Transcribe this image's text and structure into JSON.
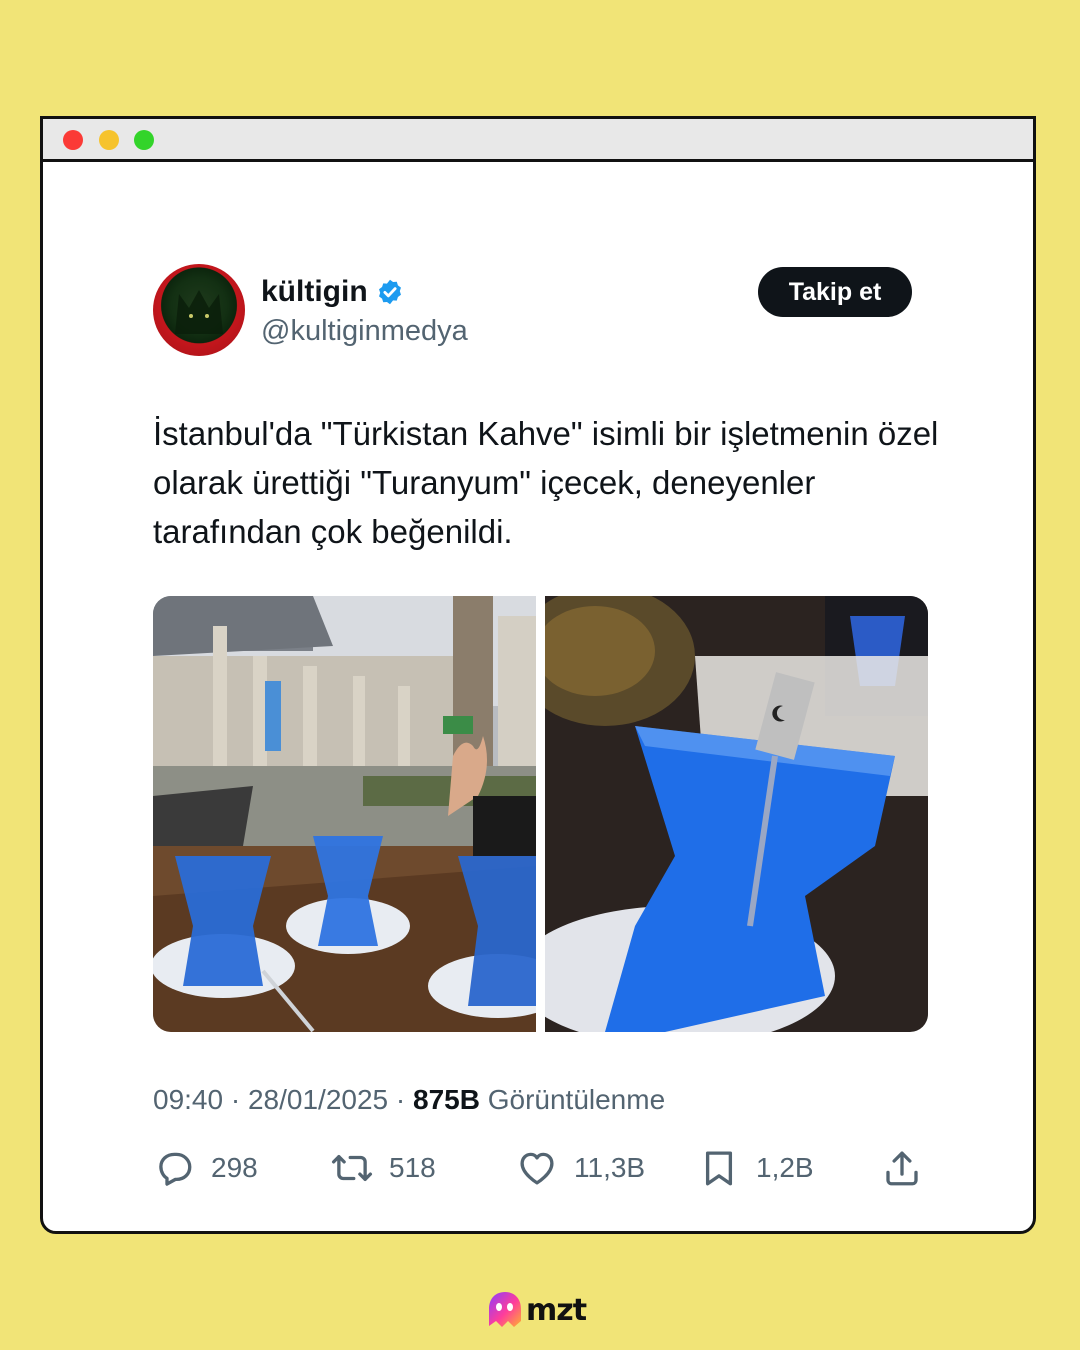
{
  "window": {
    "controls": [
      "close",
      "minimize",
      "maximize"
    ]
  },
  "tweet": {
    "author_name": "kültigin",
    "author_handle": "@kultiginmedya",
    "verified": true,
    "follow_label": "Takip et",
    "text": "İstanbul'da \"Türkistan Kahve\" isimli bir işletmenin özel olarak ürettiği \"Turanyum\" içecek, deneyenler tarafından çok beğenildi.",
    "time": "09:40",
    "date": "28/01/2025",
    "views_count": "875B",
    "views_label": "Görüntülenme",
    "media": [
      {
        "subject": "three tulip glasses of blue drink on a table in a mosque courtyard"
      },
      {
        "subject": "close-up of tulip glass of blue drink with flag spoon"
      }
    ]
  },
  "actions": {
    "replies": "298",
    "retweets": "518",
    "likes": "11,3B",
    "bookmarks": "1,2B"
  },
  "icons": [
    "verified-badge-icon",
    "reply-icon",
    "retweet-icon",
    "like-icon",
    "bookmark-icon",
    "share-icon"
  ],
  "brand": {
    "logo_text": "mzt"
  },
  "colors": {
    "background": "#f1e477",
    "verified": "#1d9bf0",
    "text_primary": "#0f1419",
    "text_secondary": "#536471"
  }
}
